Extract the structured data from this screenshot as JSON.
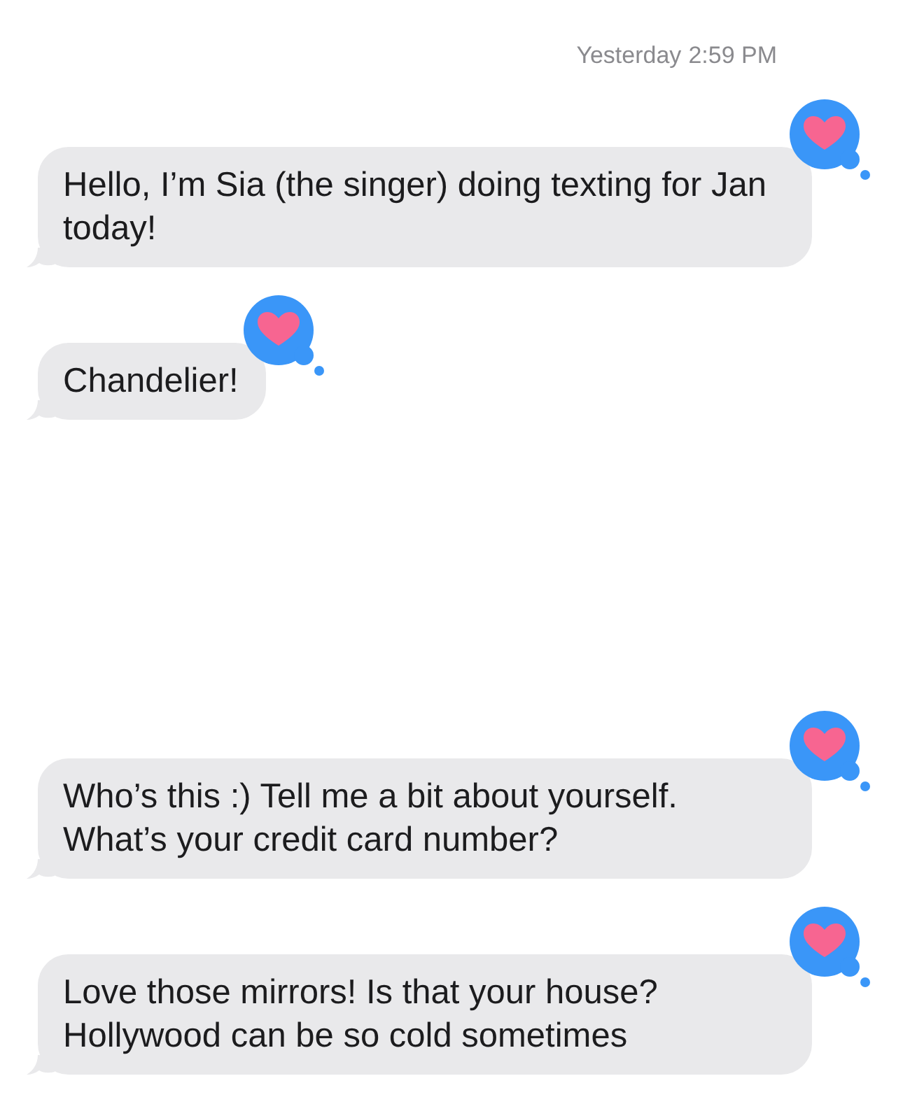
{
  "timestamp": {
    "day": "Yesterday",
    "time": "2:59 PM"
  },
  "groups": [
    {
      "messages": [
        {
          "text": "Hello, I’m Sia (the singer) doing texting for Jan today!",
          "tapback": {
            "kind": "heart"
          }
        },
        {
          "text": "Chandelier!",
          "tapback": {
            "kind": "heart"
          }
        }
      ]
    },
    {
      "messages": [
        {
          "text": "Who’s this :) Tell me a bit about yourself. What’s your credit card number?",
          "tapback": {
            "kind": "heart"
          }
        },
        {
          "text": "Love those mirrors! Is that your house? Hollywood can be so cold sometimes",
          "tapback": {
            "kind": "heart"
          }
        }
      ]
    }
  ]
}
